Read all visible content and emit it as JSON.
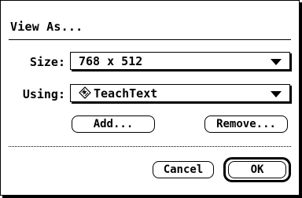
{
  "dialog": {
    "title": "View As...",
    "size_label": "Size:",
    "size_value": "768 x 512",
    "using_label": "Using:",
    "using_value": "TeachText",
    "using_icon": "teachtext-app-icon",
    "add_label": "Add...",
    "remove_label": "Remove...",
    "cancel_label": "Cancel",
    "ok_label": "OK"
  }
}
